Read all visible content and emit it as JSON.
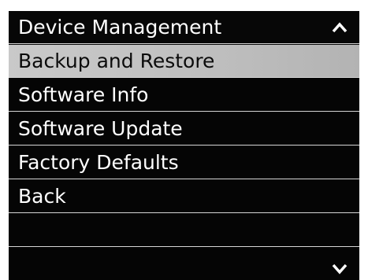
{
  "menu": {
    "title": "Device Management",
    "items": [
      {
        "label": "Backup and Restore",
        "selected": true
      },
      {
        "label": "Software Info",
        "selected": false
      },
      {
        "label": "Software Update",
        "selected": false
      },
      {
        "label": "Factory Defaults",
        "selected": false
      },
      {
        "label": "Back",
        "selected": false
      }
    ],
    "scroll_up_icon": "chevron-up-icon",
    "scroll_down_icon": "chevron-down-icon"
  },
  "colors": {
    "background": "#050505",
    "text": "#ffffff",
    "selected_background": "#c2c2c2",
    "selected_text": "#0c0c0c",
    "divider": "#d6d6d6"
  }
}
